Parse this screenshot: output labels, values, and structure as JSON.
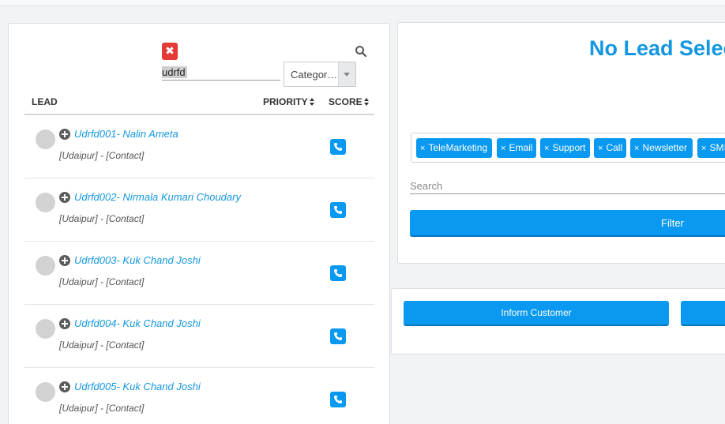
{
  "search": {
    "value": "udrfd",
    "clear_icon": "close-icon",
    "search_icon": "search-icon",
    "category_label": "Categor…"
  },
  "table": {
    "headers": {
      "lead": "LEAD",
      "priority": "PRIORITY",
      "score": "SCORE"
    },
    "rows": [
      {
        "name": "Udrfd001- Nalin Ameta",
        "meta": "[Udaipur] - [Contact]"
      },
      {
        "name": "Udrfd002- Nirmala Kumari Choudary",
        "meta": "[Udaipur] - [Contact]"
      },
      {
        "name": "Udrfd003- Kuk Chand Joshi",
        "meta": "[Udaipur] - [Contact]"
      },
      {
        "name": "Udrfd004- Kuk Chand Joshi",
        "meta": "[Udaipur] - [Contact]"
      },
      {
        "name": "Udrfd005- Kuk Chand Joshi",
        "meta": "[Udaipur] - [Contact]"
      }
    ]
  },
  "detail": {
    "title": "No Lead Selec",
    "tags": [
      "TeleMarketing",
      "Email",
      "Support",
      "Call",
      "Newsletter",
      "SMS"
    ],
    "tag_remove": "×",
    "search_placeholder": "Search",
    "filter_label": "Filter"
  },
  "actions": {
    "inform_label": "Inform Customer"
  },
  "colors": {
    "accent": "#0a99f0",
    "link": "#1497e0",
    "danger": "#e53935"
  }
}
